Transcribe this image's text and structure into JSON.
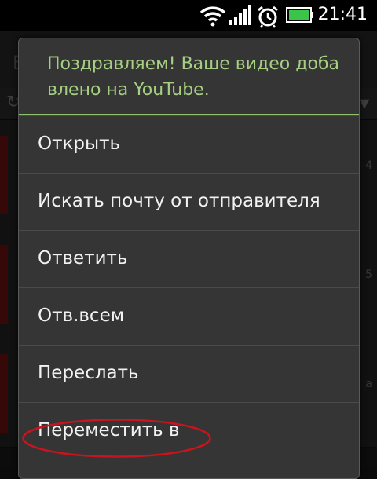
{
  "status_bar": {
    "time": "21:41",
    "icons": [
      "wifi-icon",
      "signal-icon",
      "alarm-icon",
      "battery-icon"
    ]
  },
  "background": {
    "header_letter": "E",
    "row_fragments": [
      "4",
      "5",
      "а"
    ]
  },
  "dialog": {
    "title": "Поздравляем! Ваше видео доба влено на YouTube.",
    "items": [
      {
        "label": "Открыть"
      },
      {
        "label": "Искать почту от отправителя"
      },
      {
        "label": "Ответить"
      },
      {
        "label": "Отв.всем"
      },
      {
        "label": "Переслать"
      },
      {
        "label": "Переместить в"
      }
    ],
    "accent_color": "#a6cf82",
    "annotation_color": "#c8141e"
  }
}
